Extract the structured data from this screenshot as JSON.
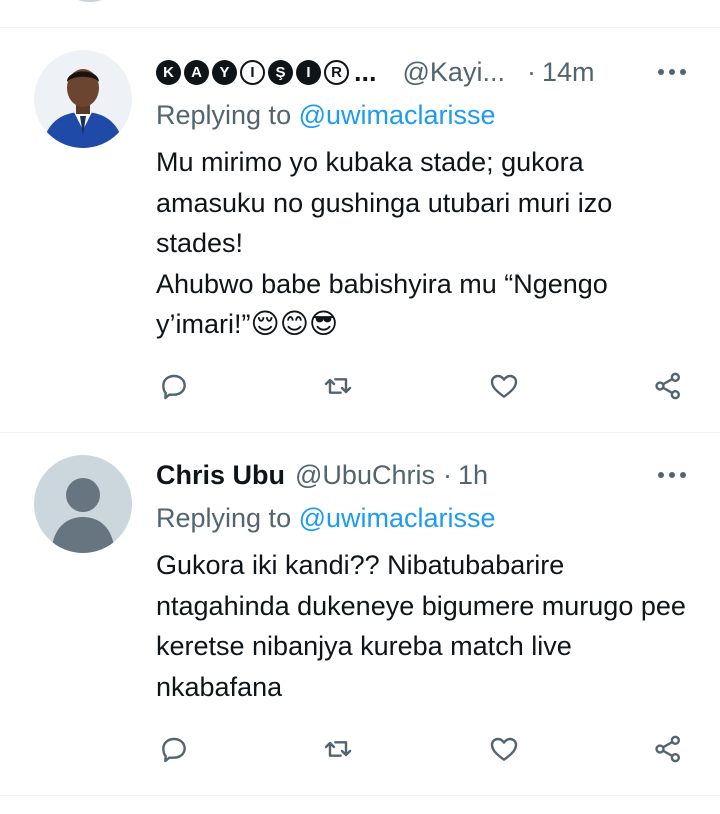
{
  "colors": {
    "accent": "#1d9bf0",
    "secondary_text": "#536471",
    "divider": "#eff3f4"
  },
  "tweets": [
    {
      "display_name_letters": [
        "K",
        "A",
        "Y",
        "I",
        "Ş",
        "I",
        "R"
      ],
      "display_name_ellipsis": "...",
      "handle": "@Kayi...",
      "separator": "·",
      "time": "14m",
      "replying_prefix": "Replying to",
      "replying_to": "@uwimaclarisse",
      "text": "Mu mirimo yo kubaka stade; gukora amasuku no gushinga utubari muri izo stades!\nAhubwo babe babishyira mu “Ngengo y’imari!”",
      "emojis": "😌😊😎",
      "avatar": "profile-photo-man-in-blue-suit",
      "actions": [
        "reply-icon",
        "retweet-icon",
        "like-icon",
        "share-icon"
      ]
    },
    {
      "display_name": "Chris Ubu",
      "handle": "@UbuChris",
      "separator": "·",
      "time": "1h",
      "replying_prefix": "Replying to",
      "replying_to": "@uwimaclarisse",
      "text": "Gukora iki kandi?? Nibatubabarire ntagahinda dukeneye bigumere murugo pee keretse nibanjya kureba match live nkabafana",
      "avatar": "default-profile-avatar",
      "actions": [
        "reply-icon",
        "retweet-icon",
        "like-icon",
        "share-icon"
      ]
    }
  ]
}
